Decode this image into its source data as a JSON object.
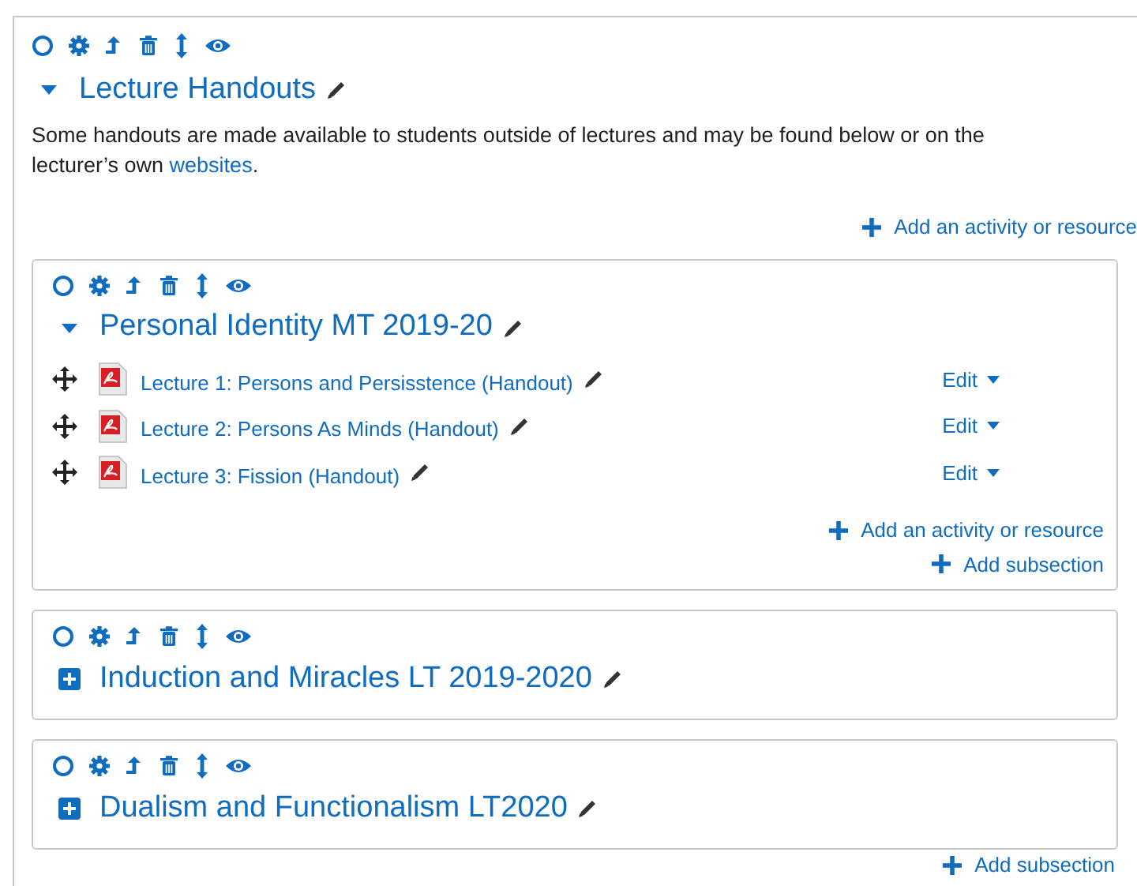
{
  "section": {
    "title": "Lecture Handouts",
    "expanded": true,
    "description": {
      "text": "Some handouts are made available to students outside of lectures and may be found below or on the lecturer’s own ",
      "link": "websites",
      "after": "."
    },
    "add_activity": "Add an activity or resource",
    "subsections": [
      {
        "title": "Personal Identity MT 2019-20",
        "expanded": true,
        "activities": [
          {
            "title": "Lecture 1: Persons and Persisstence (Handout)",
            "menu": "Edit"
          },
          {
            "title": "Lecture 2: Persons As Minds (Handout)",
            "menu": "Edit"
          },
          {
            "title": "Lecture 3: Fission (Handout)",
            "menu": "Edit"
          }
        ],
        "add_activity": "Add an activity or resource",
        "add_subsection": "Add subsection"
      },
      {
        "title": "Induction and Miracles LT 2019-2020",
        "expanded": false
      },
      {
        "title": "Dualism and Functionalism LT2020",
        "expanded": false
      }
    ],
    "add_subsection": "Add subsection"
  }
}
